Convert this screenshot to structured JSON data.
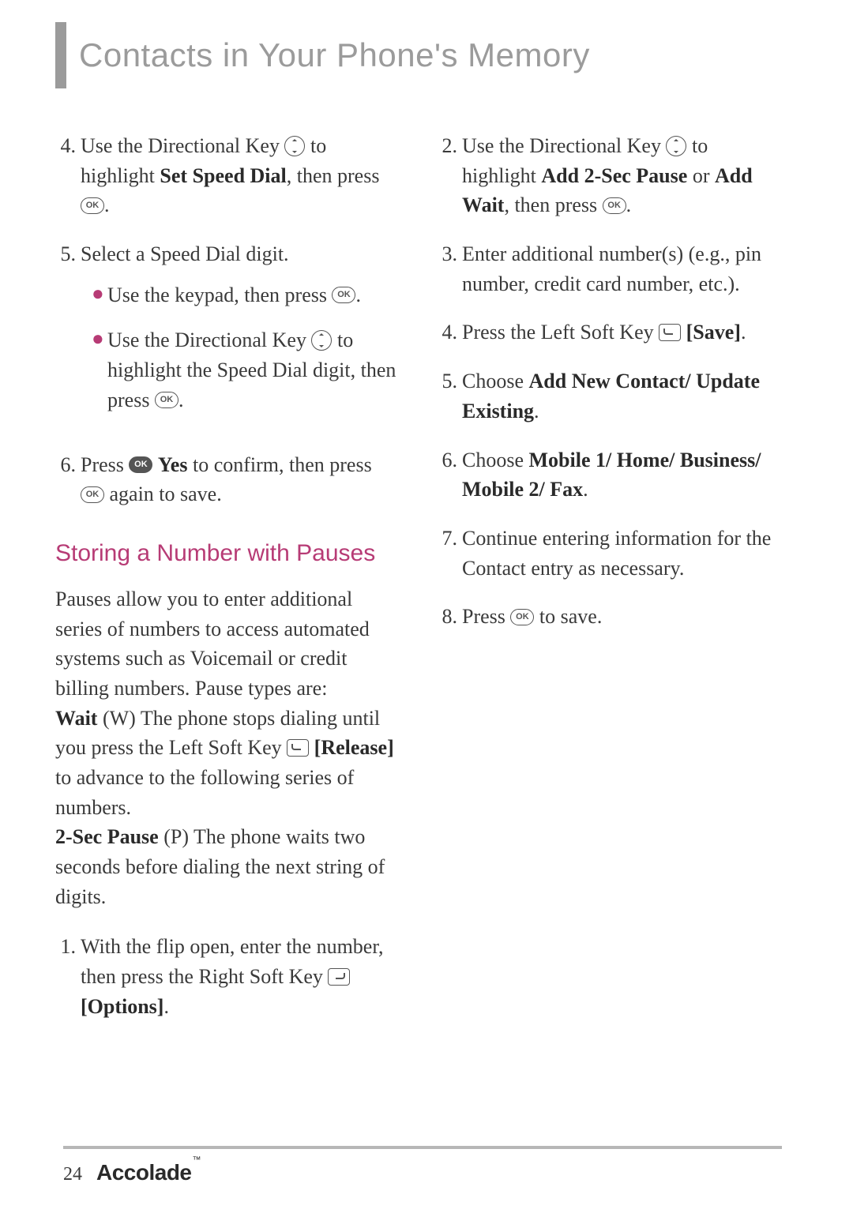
{
  "header": {
    "title": "Contacts in Your Phone's Memory"
  },
  "left": {
    "s4": {
      "num": "4.",
      "a": "Use the Directional Key ",
      "b": " to highlight ",
      "c": "Set Speed Dial",
      "d": ", then press ",
      "e": "."
    },
    "s5": {
      "num": "5.",
      "a": "Select a Speed Dial digit.",
      "b1a": "Use the keypad, then press ",
      "b1b": ".",
      "b2a": "Use the Directional Key ",
      "b2b": " to highlight the Speed Dial digit, then press ",
      "b2c": "."
    },
    "s6": {
      "num": "6.",
      "a": "Press ",
      "b": "Yes",
      "c": " to confirm, then press ",
      "d": " again to save."
    },
    "heading": "Storing a Number with Pauses",
    "p1a": "Pauses allow you to enter additional series of numbers to access automated systems such as Voicemail or credit billing numbers. Pause types are:",
    "p1b": "Wait",
    "p1c": " (W) The phone stops dialing until you press the Left Soft Key ",
    "p1d": "[Release]",
    "p1e": " to advance to the following series of numbers.",
    "p1f": "2-Sec Pause",
    "p1g": " (P) The phone waits two seconds before dialing the next string of digits.",
    "n1": {
      "num": "1.",
      "a": "With the flip open, enter the number, then press the Right Soft Key ",
      "b": "[Options]",
      "c": "."
    }
  },
  "right": {
    "s2": {
      "num": "2.",
      "a": "Use the Directional Key ",
      "b": " to highlight ",
      "c": "Add 2-Sec Pause",
      "d": " or ",
      "e": "Add Wait",
      "f": ", then press ",
      "g": "."
    },
    "s3": {
      "num": "3.",
      "a": "Enter additional number(s) (e.g., pin number, credit card number, etc.)."
    },
    "s4": {
      "num": "4.",
      "a": "Press the Left Soft Key ",
      "b": "[Save]",
      "c": "."
    },
    "s5": {
      "num": "5.",
      "a": "Choose ",
      "b": "Add New Contact/ Update Existing",
      "c": "."
    },
    "s6": {
      "num": "6.",
      "a": "Choose ",
      "b": "Mobile 1/ Home/ Business/ Mobile 2/ Fax",
      "c": "."
    },
    "s7": {
      "num": "7.",
      "a": "Continue entering information for the Contact entry as necessary."
    },
    "s8": {
      "num": "8.",
      "a": "Press ",
      "b": " to save."
    }
  },
  "footer": {
    "page": "24",
    "brand": "Accolade",
    "tm": "™"
  },
  "icons": {
    "ok": "OK"
  }
}
